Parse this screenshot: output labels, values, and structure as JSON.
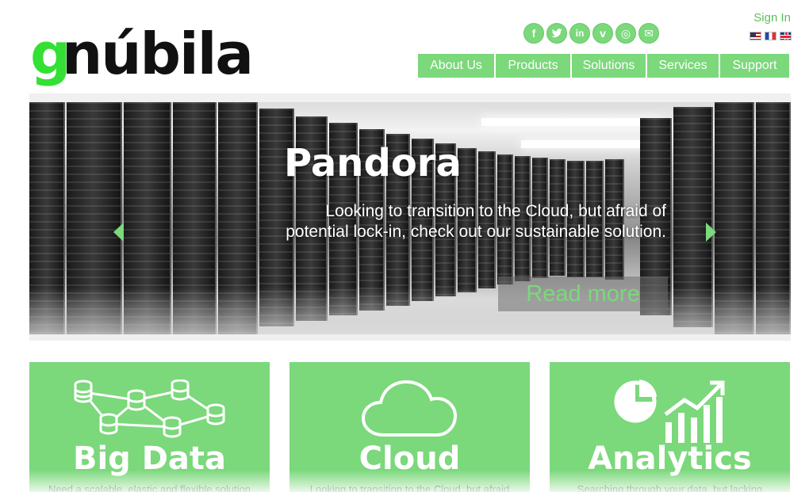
{
  "brand": {
    "logo_g": "g",
    "logo_rest": "núbila",
    "accent_color": "#7bd87b",
    "logo_green": "#33e033"
  },
  "header": {
    "signin_label": "Sign In",
    "social": [
      {
        "icon": "facebook-icon",
        "glyph": "f"
      },
      {
        "icon": "twitter-icon",
        "glyph": "t"
      },
      {
        "icon": "linkedin-icon",
        "glyph": "in"
      },
      {
        "icon": "viadeo-icon",
        "glyph": "v"
      },
      {
        "icon": "rss-icon",
        "glyph": "◎"
      },
      {
        "icon": "mail-icon",
        "glyph": "✉"
      }
    ],
    "flags": [
      "flag-us-icon",
      "flag-fr-icon",
      "flag-uk-icon"
    ]
  },
  "nav": {
    "items": [
      "About Us",
      "Products",
      "Solutions",
      "Services",
      "Support"
    ]
  },
  "slider": {
    "title": "Pandora",
    "text_line1": "Looking to transition to the Cloud, but afraid of",
    "text_line2": "potential lock-in, check out our sustainable solution.",
    "read_more": "Read more"
  },
  "cards": [
    {
      "title": "Big Data",
      "desc": "Need a scalable, elastic and flexible solution",
      "icon": "database-network-icon"
    },
    {
      "title": "Cloud",
      "desc": "Looking to transition to the Cloud, but afraid",
      "icon": "cloud-icon"
    },
    {
      "title": "Analytics",
      "desc": "Searching through your data, but lacking",
      "icon": "analytics-chart-icon"
    }
  ]
}
